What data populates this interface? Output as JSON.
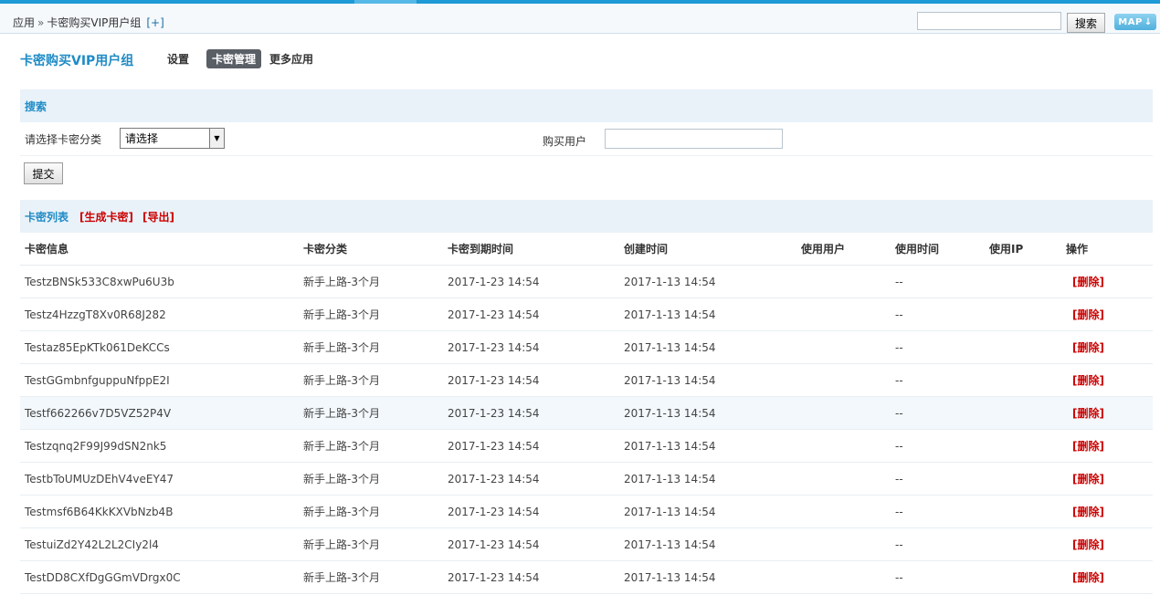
{
  "breadcrumb": {
    "root": "应用",
    "separator": "»",
    "current": "卡密购买VIP用户组",
    "add": "[+]"
  },
  "topbar": {
    "search_button": "搜索",
    "map_button": "MAP",
    "search_value": ""
  },
  "app": {
    "title": "卡密购买VIP用户组",
    "nav": [
      {
        "label": "设置",
        "active": false
      },
      {
        "label": "卡密管理",
        "active": true
      },
      {
        "label": "更多应用",
        "active": false
      }
    ]
  },
  "search": {
    "heading": "搜索",
    "category_label": "请选择卡密分类",
    "category_value": "请选择",
    "buyer_label": "购买用户",
    "buyer_value": "",
    "submit_label": "提交"
  },
  "list": {
    "heading": "卡密列表",
    "generate_link": "[生成卡密]",
    "export_link": "[导出]",
    "columns": [
      "卡密信息",
      "卡密分类",
      "卡密到期时间",
      "创建时间",
      "使用用户",
      "使用时间",
      "使用IP",
      "操作"
    ],
    "delete_label": "[删除]",
    "rows": [
      {
        "code": "TestzBNSk533C8xwPu6U3b",
        "category": "新手上路-3个月",
        "expire": "2017-1-23 14:54",
        "created": "2017-1-13 14:54",
        "user": "",
        "used_time": "--",
        "ip": ""
      },
      {
        "code": "Testz4HzzgT8Xv0R68J282",
        "category": "新手上路-3个月",
        "expire": "2017-1-23 14:54",
        "created": "2017-1-13 14:54",
        "user": "",
        "used_time": "--",
        "ip": ""
      },
      {
        "code": "Testaz85EpKTk061DeKCCs",
        "category": "新手上路-3个月",
        "expire": "2017-1-23 14:54",
        "created": "2017-1-13 14:54",
        "user": "",
        "used_time": "--",
        "ip": ""
      },
      {
        "code": "TestGGmbnfguppuNfppE2I",
        "category": "新手上路-3个月",
        "expire": "2017-1-23 14:54",
        "created": "2017-1-13 14:54",
        "user": "",
        "used_time": "--",
        "ip": ""
      },
      {
        "code": "Testf662266v7D5VZ52P4V",
        "category": "新手上路-3个月",
        "expire": "2017-1-23 14:54",
        "created": "2017-1-13 14:54",
        "user": "",
        "used_time": "--",
        "ip": ""
      },
      {
        "code": "Testzqnq2F99J99dSN2nk5",
        "category": "新手上路-3个月",
        "expire": "2017-1-23 14:54",
        "created": "2017-1-13 14:54",
        "user": "",
        "used_time": "--",
        "ip": ""
      },
      {
        "code": "TestbToUMUzDEhV4veEY47",
        "category": "新手上路-3个月",
        "expire": "2017-1-23 14:54",
        "created": "2017-1-13 14:54",
        "user": "",
        "used_time": "--",
        "ip": ""
      },
      {
        "code": "Testmsf6B64KkKXVbNzb4B",
        "category": "新手上路-3个月",
        "expire": "2017-1-23 14:54",
        "created": "2017-1-13 14:54",
        "user": "",
        "used_time": "--",
        "ip": ""
      },
      {
        "code": "TestuiZd2Y42L2L2CIy2l4",
        "category": "新手上路-3个月",
        "expire": "2017-1-23 14:54",
        "created": "2017-1-13 14:54",
        "user": "",
        "used_time": "--",
        "ip": ""
      },
      {
        "code": "TestDD8CXfDgGGmVDrgx0C",
        "category": "新手上路-3个月",
        "expire": "2017-1-23 14:54",
        "created": "2017-1-13 14:54",
        "user": "",
        "used_time": "--",
        "ip": ""
      }
    ]
  },
  "colors": {
    "accent": "#1f8bc6",
    "topline": "#1e9ad6",
    "danger": "#cc0000",
    "section_bg": "#e9f2f9"
  }
}
